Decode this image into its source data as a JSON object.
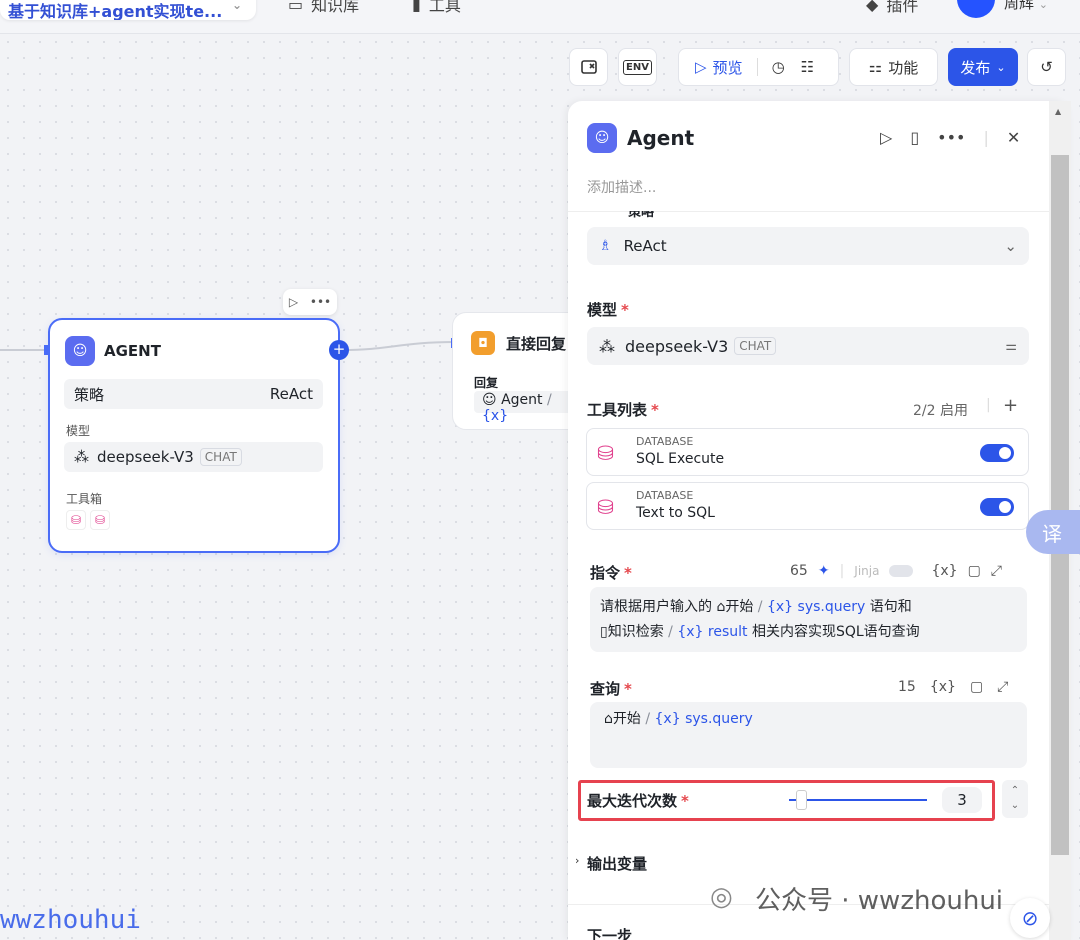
{
  "topbar": {
    "app_title": "基于知识库+agent实现te...",
    "nav_knowledge": "知识库",
    "nav_tools": "工具",
    "nav_plugins": "插件",
    "user_name": "周辉"
  },
  "toolbar": {
    "env_label": "ENV",
    "preview_label": "预览",
    "features_label": "功能",
    "publish_label": "发布"
  },
  "agent_node": {
    "title": "AGENT",
    "strategy_label": "策略",
    "strategy_value": "ReAct",
    "model_label": "模型",
    "model_name": "deepseek-V3",
    "model_tag": "CHAT",
    "toolbox_label": "工具箱"
  },
  "reply_node": {
    "title": "直接回复",
    "reply_label": "回复",
    "reply_source": "Agent",
    "reply_var": "{x}"
  },
  "panel": {
    "title": "Agent",
    "description_placeholder": "添加描述...",
    "strategy_section_label": "策略",
    "strategy_value": "ReAct",
    "model_label": "模型",
    "model_name": "deepseek-V3",
    "model_tag": "CHAT",
    "tools_label": "工具列表",
    "tools_count": "2/2 启用",
    "tools": [
      {
        "category": "DATABASE",
        "name": "SQL Execute",
        "enabled": true
      },
      {
        "category": "DATABASE",
        "name": "Text to SQL",
        "enabled": true
      }
    ],
    "instruction_label": "指令",
    "instruction_count": "65",
    "jinja_label": "Jinja",
    "var_icon": "{x}",
    "instruction_text": {
      "part1": "请根据用户输入的",
      "start_node": "开始",
      "var1": "sys.query",
      "part2": "语句和",
      "kb_node": "知识检索",
      "var2": "result",
      "part3": "相关内容实现SQL语句查询"
    },
    "query_label": "查询",
    "query_count": "15",
    "query_start_node": "开始",
    "query_var": "sys.query",
    "max_iter_label": "最大迭代次数",
    "max_iter_value": "3",
    "max_iter_level": 0.1,
    "output_vars_label": "输出变量",
    "next_step_label": "下一步"
  },
  "translate_btn": "译",
  "watermarks": {
    "left": "wwzhouhui",
    "right": "公众号 · wwzhouhui"
  },
  "colors": {
    "accent": "#2c55e8",
    "highlight": "#e6424f",
    "db_icon": "#e03e8c"
  }
}
